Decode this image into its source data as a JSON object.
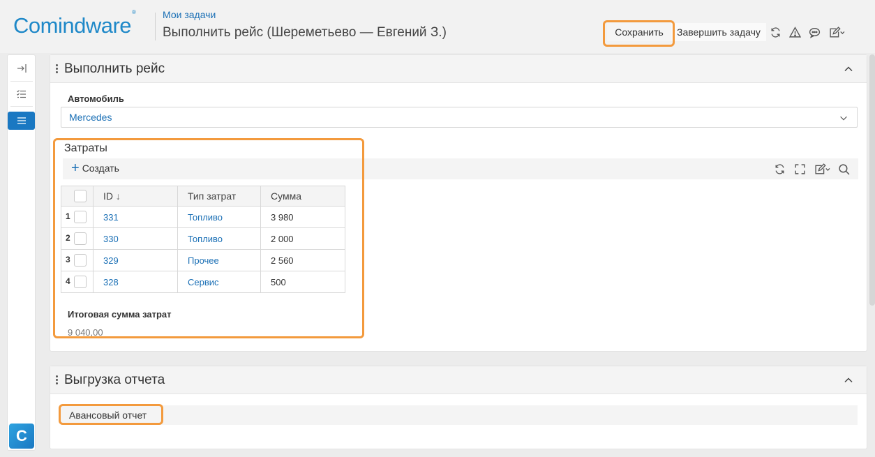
{
  "header": {
    "logo_text": "Comindware",
    "logo_mark": "®",
    "breadcrumb": "Мои задачи",
    "title": "Выполнить рейс (Шереметьево — Евгений З.)",
    "toolbar": {
      "save_label": "Сохранить",
      "finish_label": "Завершить задачу",
      "icons": [
        "refresh-icon",
        "warning-icon",
        "comment-icon",
        "edit-dropdown-icon"
      ]
    }
  },
  "rail": {
    "items": [
      "expand-icon",
      "checklist-icon",
      "list-icon"
    ],
    "app_letter": "C"
  },
  "panel_trip": {
    "title": "Выполнить рейс",
    "car_label": "Автомобиль",
    "car_value": "Mercedes",
    "expenses": {
      "title": "Затраты",
      "create_label": "Создать",
      "columns": {
        "id": "ID",
        "type": "Тип затрат",
        "sum": "Сумма"
      },
      "sort_arrow": "↓",
      "rows": [
        {
          "n": "1",
          "id": "331",
          "type": "Топливо",
          "sum": "3 980"
        },
        {
          "n": "2",
          "id": "330",
          "type": "Топливо",
          "sum": "2 000"
        },
        {
          "n": "3",
          "id": "329",
          "type": "Прочее",
          "sum": "2 560"
        },
        {
          "n": "4",
          "id": "328",
          "type": "Сервис",
          "sum": "500"
        }
      ]
    },
    "total_label": "Итоговая сумма затрат",
    "total_value": "9 040,00"
  },
  "panel_report": {
    "title": "Выгрузка отчета",
    "report_button": "Авансовый отчет"
  },
  "colors": {
    "accent": "#1a78c2",
    "link": "#1a6fb5",
    "highlight": "#f39a3d"
  }
}
